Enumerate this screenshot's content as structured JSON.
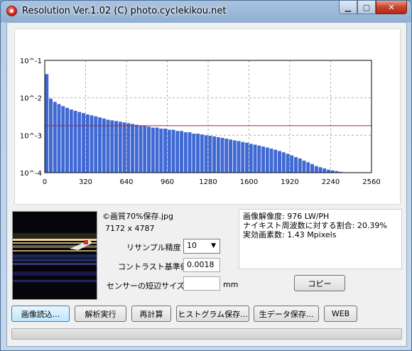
{
  "window": {
    "title": "Resolution Ver.1.02 (C) photo.cyclekikou.net",
    "min_icon": "minimize-icon",
    "max_icon": "maximize-icon",
    "close_icon": "close-icon"
  },
  "chart_data": {
    "type": "bar",
    "title": "",
    "xlabel": "",
    "ylabel": "",
    "y_scale": "log",
    "ylim": [
      0.0001,
      0.1
    ],
    "xlim": [
      0,
      2560
    ],
    "x_ticks": [
      "0",
      "320",
      "640",
      "960",
      "1280",
      "1600",
      "1920",
      "2240",
      "2560"
    ],
    "y_ticks": [
      "10^-1",
      "10^-2",
      "10^-3",
      "10^-4"
    ],
    "grid": true,
    "bar_color": "#4169d4",
    "threshold_line": {
      "value": 0.0018,
      "color": "#b22222"
    },
    "bar_width": 32,
    "x": [
      16,
      48,
      80,
      112,
      144,
      176,
      208,
      240,
      272,
      304,
      336,
      368,
      400,
      432,
      464,
      496,
      528,
      560,
      592,
      624,
      656,
      688,
      720,
      752,
      784,
      816,
      848,
      880,
      912,
      944,
      976,
      1008,
      1040,
      1072,
      1104,
      1136,
      1168,
      1200,
      1232,
      1264,
      1296,
      1328,
      1360,
      1392,
      1424,
      1456,
      1488,
      1520,
      1552,
      1584,
      1616,
      1648,
      1680,
      1712,
      1744,
      1776,
      1808,
      1840,
      1872,
      1904,
      1936,
      1968,
      2000,
      2032,
      2064,
      2096,
      2128,
      2160,
      2192,
      2224,
      2256,
      2288,
      2320,
      2352
    ],
    "values": [
      0.043,
      0.0095,
      0.0078,
      0.0068,
      0.006,
      0.0054,
      0.0049,
      0.0045,
      0.0042,
      0.0039,
      0.0036,
      0.0034,
      0.0032,
      0.003,
      0.0028,
      0.0026,
      0.0025,
      0.0024,
      0.0023,
      0.0022,
      0.0021,
      0.002,
      0.0019,
      0.0018,
      0.0018,
      0.0017,
      0.0016,
      0.0016,
      0.0015,
      0.0015,
      0.0014,
      0.0014,
      0.0013,
      0.0013,
      0.0012,
      0.0012,
      0.0011,
      0.0011,
      0.00105,
      0.001,
      0.00097,
      0.00093,
      0.00089,
      0.00085,
      0.00081,
      0.00077,
      0.00073,
      0.0007,
      0.00066,
      0.00063,
      0.00059,
      0.00056,
      0.00053,
      0.0005,
      0.00047,
      0.00044,
      0.00041,
      0.00038,
      0.00035,
      0.00032,
      0.00029,
      0.00026,
      0.00024,
      0.00021,
      0.00019,
      0.00017,
      0.00015,
      0.00014,
      0.00013,
      0.00012,
      0.000115,
      0.00011,
      0.000105,
      0.000102
    ]
  },
  "file": {
    "name": "©画質70%保存.jpg",
    "dimensions": "7172 x 4787"
  },
  "settings": {
    "resample_label": "リサンプル精度",
    "resample_value": "10",
    "contrast_label": "コントラスト基準値",
    "contrast_value": "0.0018",
    "sensor_label": "センサーの短辺サイズ",
    "sensor_value": "",
    "sensor_unit": "mm"
  },
  "results": {
    "line1": "画像解像度: 976 LW/PH",
    "line2": "ナイキスト周波数に対する割合: 20.39%",
    "line3": "実効画素数: 1.43 Mpixels"
  },
  "buttons": {
    "copy": "コピー",
    "load": "画像読込...",
    "analyze": "解析実行",
    "recalc": "再計算",
    "save_hist": "ヒストグラム保存...",
    "save_raw": "生データ保存...",
    "web": "WEB"
  },
  "progress": {
    "value": 0
  }
}
